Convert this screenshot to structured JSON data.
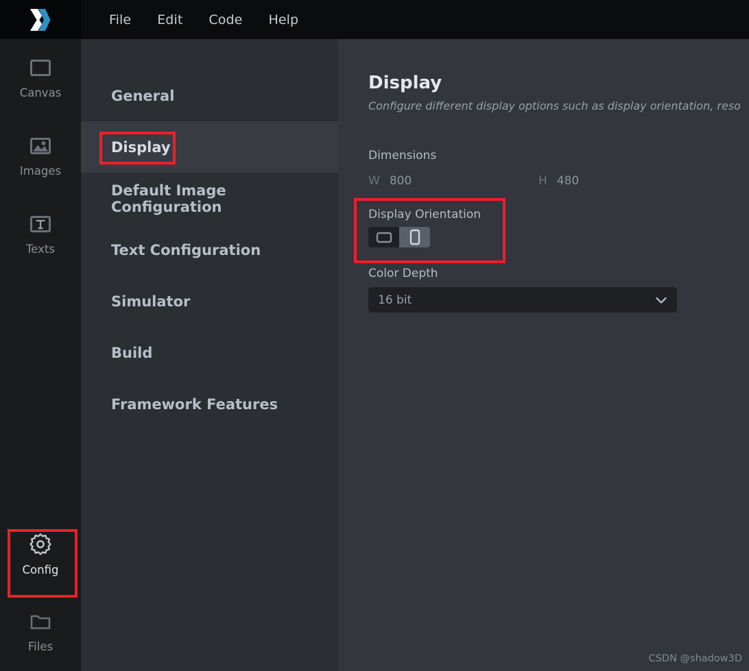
{
  "menubar": {
    "logo_name": "x-logo",
    "items": [
      {
        "label": "File"
      },
      {
        "label": "Edit"
      },
      {
        "label": "Code"
      },
      {
        "label": "Help"
      }
    ]
  },
  "rail": {
    "items": [
      {
        "id": "canvas",
        "label": "Canvas",
        "icon": "canvas-icon",
        "active": false
      },
      {
        "id": "images",
        "label": "Images",
        "icon": "image-icon",
        "active": false
      },
      {
        "id": "texts",
        "label": "Texts",
        "icon": "text-icon",
        "active": false
      },
      {
        "id": "config",
        "label": "Config",
        "icon": "gear-icon",
        "active": true
      },
      {
        "id": "files",
        "label": "Files",
        "icon": "folder-icon",
        "active": false
      }
    ]
  },
  "nav": {
    "items": [
      {
        "label": "General",
        "selected": false
      },
      {
        "label": "Display",
        "selected": true
      },
      {
        "label": "Default Image Configuration",
        "selected": false
      },
      {
        "label": "Text Configuration",
        "selected": false
      },
      {
        "label": "Simulator",
        "selected": false
      },
      {
        "label": "Build",
        "selected": false
      },
      {
        "label": "Framework Features",
        "selected": false
      }
    ]
  },
  "main": {
    "title": "Display",
    "subtitle": "Configure different display options such as display orientation, reso",
    "dimensions": {
      "label": "Dimensions",
      "width_key": "W",
      "width_value": "800",
      "height_key": "H",
      "height_value": "480"
    },
    "orientation": {
      "label": "Display Orientation",
      "options": [
        {
          "id": "landscape",
          "icon": "landscape-icon",
          "selected": true
        },
        {
          "id": "portrait",
          "icon": "portrait-icon",
          "selected": false
        }
      ]
    },
    "color_depth": {
      "label": "Color Depth",
      "value": "16 bit",
      "chevron": "chevron-down-icon"
    }
  },
  "watermark": {
    "text": "CSDN @shadow3D"
  },
  "annotations": {
    "accent_color": "#f01e28",
    "boxes": [
      {
        "target": "rail-item-config"
      },
      {
        "target": "nav-item-display"
      },
      {
        "target": "display-orientation-group"
      }
    ]
  }
}
